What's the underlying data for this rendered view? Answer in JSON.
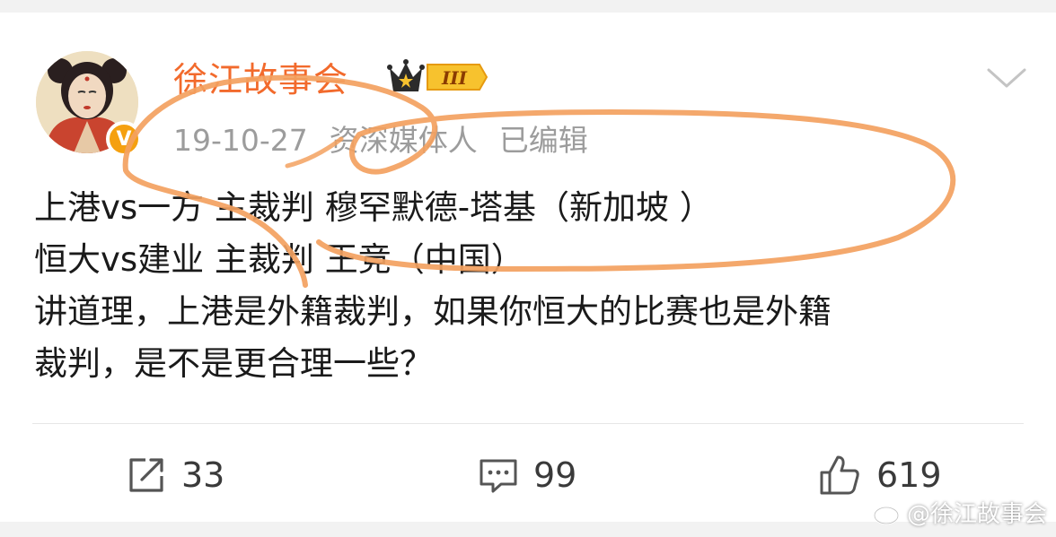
{
  "post": {
    "username": "徐江故事会",
    "level_badge": "III",
    "date": "19-10-27",
    "source": "资深媒体人",
    "edited": "已编辑",
    "verified_badge": "V",
    "lines": [
      "上港vs一方 主裁判 穆罕默德-塔基（新加坡 ）",
      "恒大vs建业 主裁判 王竞（中国）",
      "讲道理，上港是外籍裁判，如果你恒大的比赛也是外籍",
      "裁判，是不是更合理一些？"
    ]
  },
  "actions": {
    "repost_count": "33",
    "comment_count": "99",
    "like_count": "619"
  },
  "watermark": "@徐江故事会",
  "colors": {
    "username": "#f26a2c",
    "annotation_stroke": "#f3a15f",
    "badge_gold": "#f5a00f",
    "meta_text": "#9c9c9c"
  },
  "icons": [
    "avatar",
    "verified-badge-icon",
    "crown-level-icon",
    "chevron-down-icon",
    "repost-icon",
    "comment-icon",
    "like-icon",
    "weibo-logo-icon"
  ]
}
